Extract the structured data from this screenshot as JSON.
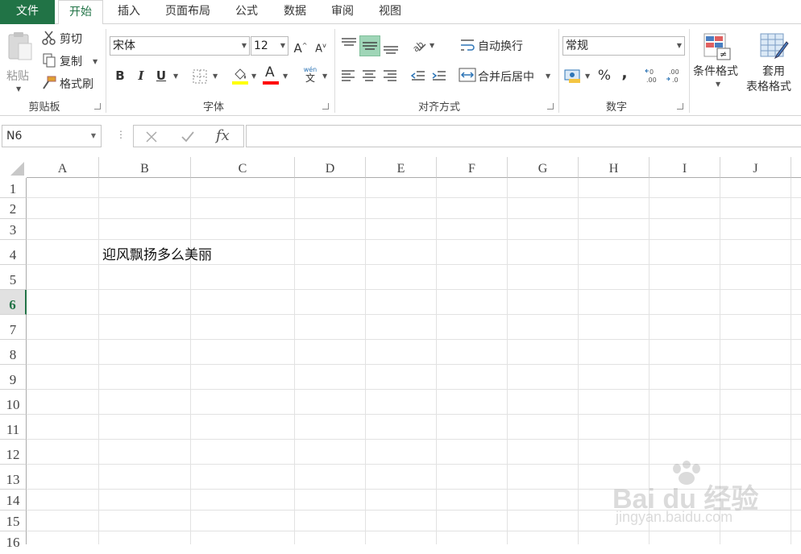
{
  "menu": {
    "tabs": [
      "文件",
      "开始",
      "插入",
      "页面布局",
      "公式",
      "数据",
      "审阅",
      "视图"
    ]
  },
  "clipboard": {
    "paste_label": "粘贴",
    "cut_label": "剪切",
    "copy_label": "复制",
    "format_painter_label": "格式刷",
    "group_label": "剪贴板"
  },
  "font": {
    "family": "宋体",
    "size": "12",
    "group_label": "字体",
    "grow_label": "A",
    "shrink_label": "A",
    "bold_label": "B",
    "italic_label": "I",
    "underline_label": "U",
    "fontcolor_label": "A",
    "phonetic_top": "wén",
    "phonetic_bottom": "文"
  },
  "alignment": {
    "wrap_label": "自动换行",
    "merge_label": "合并后居中",
    "group_label": "对齐方式"
  },
  "number": {
    "format": "常规",
    "percent_label": "%",
    "comma_label": ",",
    "group_label": "数字"
  },
  "styles": {
    "conditional_label": "条件格式",
    "table_label_1": "套用",
    "table_label_2": "表格格式"
  },
  "formula_bar": {
    "name_box": "N6",
    "fx_label": "fx"
  },
  "sheet": {
    "columns": [
      "A",
      "B",
      "C",
      "D",
      "E",
      "F",
      "G",
      "H",
      "I",
      "J"
    ],
    "rows": [
      "1",
      "2",
      "3",
      "4",
      "5",
      "6",
      "7",
      "8",
      "9",
      "10",
      "11",
      "12",
      "13",
      "14",
      "15",
      "16"
    ],
    "selected_row": "6",
    "cell_B4": "迎风飘扬多么美丽"
  },
  "watermark": {
    "brand": "Bai du 经验",
    "url": "jingyan.baidu.com"
  },
  "colors": {
    "accent": "#217346",
    "highlight_yellow": "#ffff00",
    "font_red": "#ff0000"
  }
}
